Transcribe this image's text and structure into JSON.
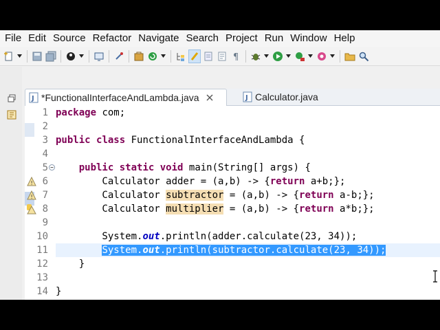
{
  "menubar": {
    "items": [
      "File",
      "Edit",
      "Source",
      "Refactor",
      "Navigate",
      "Search",
      "Project",
      "Run",
      "Window",
      "Help"
    ]
  },
  "toolbar": {
    "icons": [
      "new-icon",
      "save-icon",
      "save-all-icon",
      "debug-person-icon",
      "console-icon",
      "pin-icon",
      "build-icon",
      "refresh-icon",
      "hierarchy-icon",
      "highlight-icon",
      "mark-occurrences-icon",
      "edit-icon",
      "pilcrow-icon",
      "debug-icon",
      "run-icon",
      "external-tools-icon",
      "open-type-icon",
      "search-icon"
    ]
  },
  "tabs": [
    {
      "label": "*FunctionalInterfaceAndLambda.java",
      "active": true,
      "dirty": true
    },
    {
      "label": "Calculator.java",
      "active": false,
      "dirty": false
    }
  ],
  "editor": {
    "lines": [
      {
        "num": "1",
        "text": "package com;"
      },
      {
        "num": "2",
        "text": ""
      },
      {
        "num": "3",
        "text": "public class FunctionalInterfaceAndLambda {"
      },
      {
        "num": "4",
        "text": ""
      },
      {
        "num": "5",
        "text": "    public static void main(String[] args) {"
      },
      {
        "num": "6",
        "text": "        Calculator adder = (a,b) -> {return a+b;};"
      },
      {
        "num": "7",
        "text": "        Calculator subtractor = (a,b) -> {return a-b;};"
      },
      {
        "num": "8",
        "text": "        Calculator multiplier = (a,b) -> {return a*b;};"
      },
      {
        "num": "9",
        "text": ""
      },
      {
        "num": "10",
        "text": "        System.out.println(adder.calculate(23, 34));"
      },
      {
        "num": "11",
        "text": "        System.out.println(subtractor.calculate(23, 34));"
      },
      {
        "num": "12",
        "text": "    }"
      },
      {
        "num": "13",
        "text": ""
      },
      {
        "num": "14",
        "text": "}"
      }
    ],
    "selected_line": "11"
  },
  "colors": {
    "keyword": "#7f0055",
    "field": "#0000c0",
    "selection": "#3399ff",
    "occurrence": "#f5deb3",
    "current_line": "#e8f2fe"
  }
}
